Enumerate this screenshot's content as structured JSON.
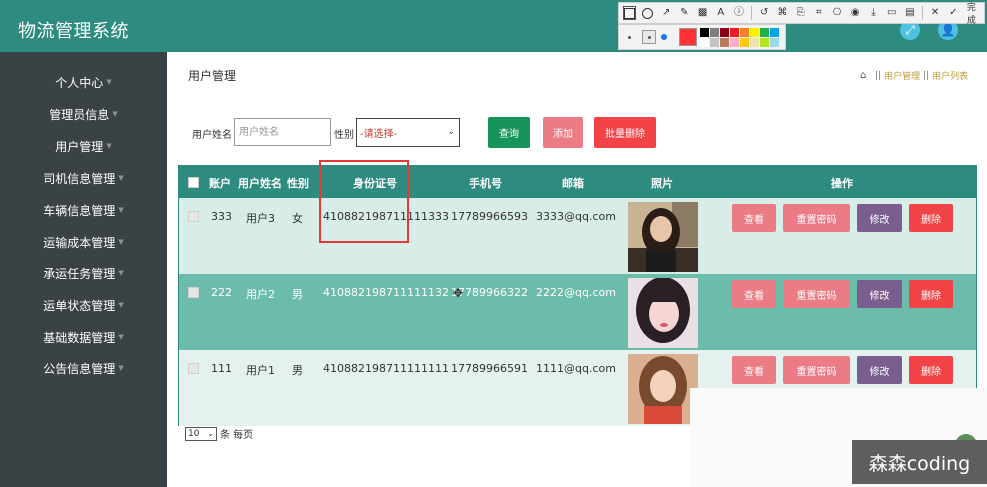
{
  "header": {
    "app_title": "物流管理系统",
    "expand_icon": "⤢",
    "user_icon": "👤"
  },
  "snip_toolbar": {
    "done_label": "完成",
    "current_color": "#ff3333",
    "swatches": [
      "#000000",
      "#7f7f7f",
      "#880015",
      "#ed1c24",
      "#ff7f27",
      "#fff200",
      "#22b14c",
      "#00a2e8",
      "#ffffff",
      "#c3c3c3",
      "#b97a57",
      "#ffaec9",
      "#ffc90e",
      "#efe4b0",
      "#b5e61d",
      "#99d9ea"
    ]
  },
  "sidebar": {
    "items": [
      {
        "label": "个人中心"
      },
      {
        "label": "管理员信息"
      },
      {
        "label": "用户管理"
      },
      {
        "label": "司机信息管理"
      },
      {
        "label": "车辆信息管理"
      },
      {
        "label": "运输成本管理"
      },
      {
        "label": "承运任务管理"
      },
      {
        "label": "运单状态管理"
      },
      {
        "label": "基础数据管理"
      },
      {
        "label": "公告信息管理"
      }
    ]
  },
  "page": {
    "title": "用户管理",
    "breadcrumb": {
      "level1": "用户管理",
      "level2": "用户列表"
    }
  },
  "search": {
    "name_label": "用户姓名",
    "name_placeholder": "用户姓名",
    "gender_label": "性别",
    "gender_selected": "-请选择-",
    "query_label": "查询",
    "add_label": "添加",
    "bulk_delete_label": "批量删除"
  },
  "table": {
    "headers": {
      "account": "账户",
      "name": "用户姓名",
      "gender": "性别",
      "id_card": "身份证号",
      "phone": "手机号",
      "email": "邮箱",
      "photo": "照片",
      "ops": "操作"
    },
    "rows": [
      {
        "account": "333",
        "name": "用户3",
        "gender": "女",
        "id_card": "410882198711111333",
        "phone": "17789966593",
        "email": "3333@qq.com"
      },
      {
        "account": "222",
        "name": "用户2",
        "gender": "男",
        "id_card": "410882198711111132",
        "phone": "17789966322",
        "email": "2222@qq.com"
      },
      {
        "account": "111",
        "name": "用户1",
        "gender": "男",
        "id_card": "410882198711111111",
        "phone": "17789966591",
        "email": "1111@qq.com"
      }
    ],
    "actions": {
      "view": "查看",
      "reset": "重置密码",
      "edit": "修改",
      "delete": "删除"
    }
  },
  "pager": {
    "page_size": "10",
    "suffix": "条 每页"
  },
  "watermark": "森森coding"
}
